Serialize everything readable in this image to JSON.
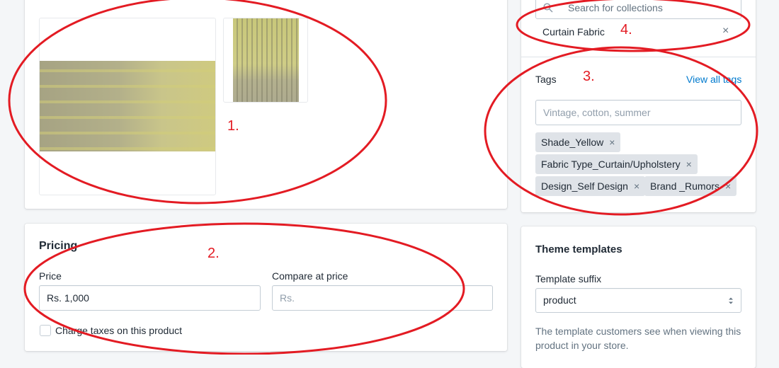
{
  "media": {
    "items": [
      "fabric-photo-wide",
      "fabric-photo-tall"
    ]
  },
  "pricing": {
    "title": "Pricing",
    "price_label": "Price",
    "price_value": "Rs. 1,000",
    "compare_label": "Compare at price",
    "compare_placeholder": "Rs.",
    "taxes_label": "Charge taxes on this product",
    "taxes_checked": false
  },
  "collections": {
    "search_placeholder": "Search for collections",
    "selected": [
      {
        "label": "Curtain Fabric"
      }
    ]
  },
  "tags": {
    "title": "Tags",
    "view_all": "View all tags",
    "input_placeholder": "Vintage, cotton, summer",
    "items": [
      {
        "label": "Shade_Yellow"
      },
      {
        "label": "Fabric Type_Curtain/Upholstery"
      },
      {
        "label": "Design_Self Design"
      },
      {
        "label": "Brand _Rumors"
      }
    ]
  },
  "theme_templates": {
    "title": "Theme templates",
    "suffix_label": "Template suffix",
    "suffix_value": "product",
    "help_text": "The template customers see when viewing this product in your store."
  },
  "annotations": {
    "labels": [
      "1.",
      "2.",
      "3.",
      "4."
    ],
    "color": "#e31b23"
  },
  "colors": {
    "link": "#007ace",
    "tag_bg": "#dfe3e8",
    "page_bg": "#f4f6f8"
  }
}
